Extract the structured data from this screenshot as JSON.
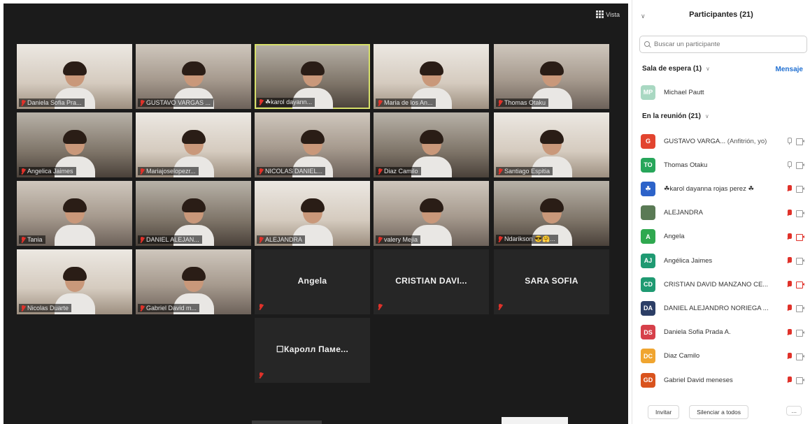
{
  "view": {
    "label": "Vista"
  },
  "tiles": [
    {
      "name": "Daniela Sofia Pra...",
      "video": true
    },
    {
      "name": "GUSTAVO VARGAS ...",
      "video": true
    },
    {
      "name": "☘karol dayann...",
      "video": true,
      "active": true
    },
    {
      "name": "Maria de los An...",
      "video": true
    },
    {
      "name": "Thomas Otaku",
      "video": true
    },
    {
      "name": "Angelica Jaimes",
      "video": true
    },
    {
      "name": "Mariajoselopezr...",
      "video": true
    },
    {
      "name": "NICOLAS DANIEL...",
      "video": true
    },
    {
      "name": "Diaz Camilo",
      "video": true
    },
    {
      "name": "Santiago Espitia",
      "video": true
    },
    {
      "name": "Tania",
      "video": true
    },
    {
      "name": "DANIEL ALEJAN...",
      "video": true
    },
    {
      "name": "ALEJANDRA",
      "video": true
    },
    {
      "name": "valery Mejia",
      "video": true
    },
    {
      "name": "Ndarikson 😎🤗...",
      "video": true
    },
    {
      "name": "Nicolas Duarte",
      "video": true
    },
    {
      "name": "Gabriel David m...",
      "video": true
    },
    {
      "name": "Angela",
      "video": false
    },
    {
      "name": "CRISTIAN DAVI...",
      "video": false
    },
    {
      "name": "SARA SOFIA",
      "video": false
    },
    {
      "name": "☐Каролл Паме...",
      "video": false
    }
  ],
  "panel": {
    "title": "Participantes (21)",
    "search_placeholder": "Buscar un participante",
    "waiting_label": "Sala de espera (1)",
    "message_label": "Mensaje",
    "waiting": [
      {
        "initials": "MP",
        "name": "Michael Pautt",
        "color": "#a9d8c2"
      }
    ],
    "meeting_label": "En la reunión (21)",
    "participants": [
      {
        "initials": "G",
        "name": "GUSTAVO VARGA...",
        "role": "(Anfitrión, yo)",
        "color": "#e2442f",
        "mic": "on",
        "cam": "on"
      },
      {
        "initials": "TO",
        "name": "Thomas Otaku",
        "role": "",
        "color": "#27a65a",
        "mic": "on",
        "cam": "on"
      },
      {
        "initials": "☘",
        "name": "☘karol dayanna rojas perez ☘",
        "role": "",
        "color": "#2d63c9",
        "mic": "off",
        "cam": "on"
      },
      {
        "initials": "",
        "name": "ALEJANDRA",
        "role": "",
        "color": "#5a7a55",
        "mic": "off",
        "cam": "on"
      },
      {
        "initials": "A",
        "name": "Angela",
        "role": "",
        "color": "#2fa84f",
        "mic": "off",
        "cam": "off"
      },
      {
        "initials": "AJ",
        "name": "Angélica Jaimes",
        "role": "",
        "color": "#1f9a72",
        "mic": "off",
        "cam": "on"
      },
      {
        "initials": "CD",
        "name": "CRISTIAN DAVID MANZANO CE...",
        "role": "",
        "color": "#1f9a72",
        "mic": "off",
        "cam": "off"
      },
      {
        "initials": "DA",
        "name": "DANIEL ALEJANDRO NORIEGA ...",
        "role": "",
        "color": "#2c3e66",
        "mic": "off",
        "cam": "on"
      },
      {
        "initials": "DS",
        "name": "Daniela Sofia Prada A.",
        "role": "",
        "color": "#d6404a",
        "mic": "off",
        "cam": "on"
      },
      {
        "initials": "DC",
        "name": "Diaz Camilo",
        "role": "",
        "color": "#f0a530",
        "mic": "off",
        "cam": "on"
      },
      {
        "initials": "GD",
        "name": "Gabriel David meneses",
        "role": "",
        "color": "#d9531e",
        "mic": "off",
        "cam": "on"
      }
    ],
    "invite_label": "Invitar",
    "mute_all_label": "Silenciar a todos",
    "more_label": "..."
  }
}
